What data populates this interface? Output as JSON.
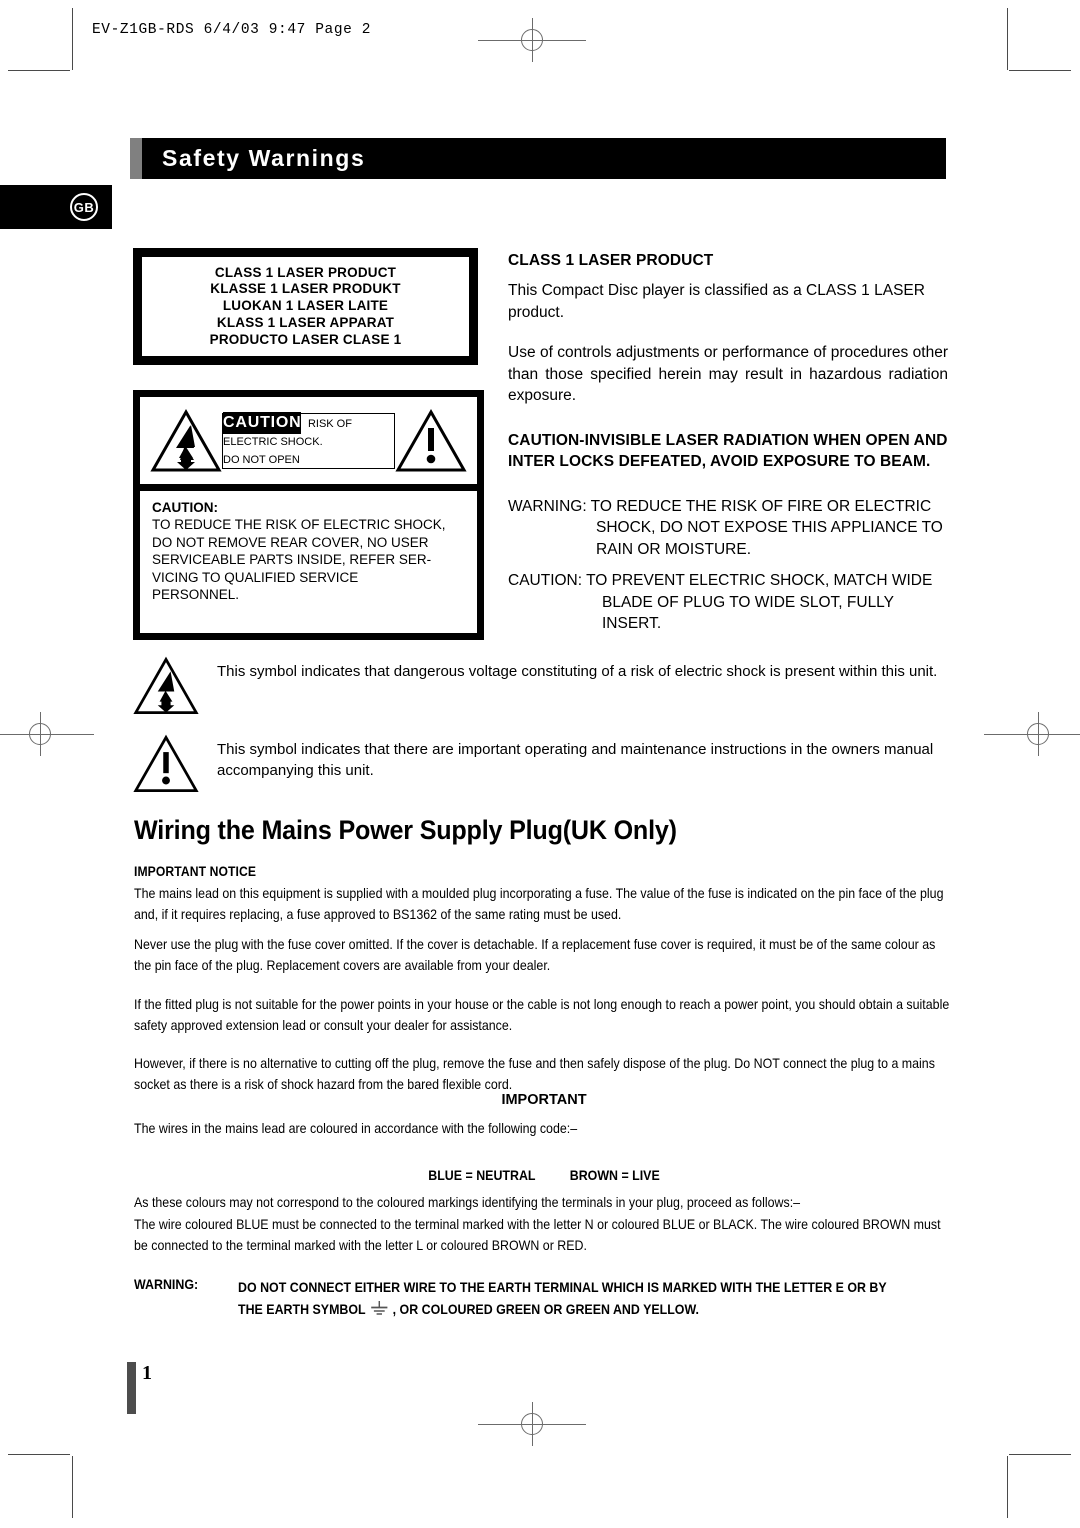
{
  "print_header": {
    "text": "EV-Z1GB-RDS  6/4/03 9:47  Page 2"
  },
  "header": {
    "title": "Safety Warnings",
    "region_badge": "GB"
  },
  "laser_label_box": {
    "lines": [
      "CLASS 1 LASER PRODUCT",
      "KLASSE 1 LASER PRODUKT",
      "LUOKAN 1 LASER LAITE",
      "KLASS 1 LASER APPARAT",
      "PRODUCTO LASER CLASE 1"
    ]
  },
  "caution_label": {
    "heading": "CAUTION",
    "line1": "RISK OF ELECTRIC SHOCK.",
    "line2": "DO NOT OPEN",
    "body_heading": "CAUTION:",
    "body": "TO REDUCE THE RISK OF ELECTRIC SHOCK, DO NOT REMOVE REAR COVER, NO USER SERVICEABLE PARTS INSIDE, REFER SER-VICING TO QUALIFIED SERVICE PERSONNEL.",
    "body_lines": [
      "TO REDUCE THE RISK OF ELECTRIC SHOCK,",
      "DO NOT REMOVE REAR COVER, NO USER",
      "SERVICEABLE PARTS INSIDE, REFER SER-",
      "VICING TO QUALIFIED SERVICE",
      "PERSONNEL."
    ]
  },
  "right_column": {
    "class1_heading": "CLASS 1 LASER PRODUCT",
    "class1_body": "This Compact Disc player is classified as a CLASS 1 LASER product.",
    "controls_body": "Use of controls adjustments or performance of procedures other than those specified herein may result in hazardous radiation exposure.",
    "invisible_heading": "CAUTION-INVISIBLE LASER RADIATION WHEN OPEN AND INTER LOCKS DEFEATED, AVOID EXPOSURE TO BEAM.",
    "warning_block": "WARNING: TO REDUCE THE RISK OF FIRE OR ELECTRIC SHOCK, DO NOT EXPOSE THIS APPLIANCE TO RAIN OR MOISTURE.",
    "caution_block": "CAUTION: TO PREVENT ELECTRIC SHOCK, MATCH WIDE BLADE OF PLUG TO WIDE SLOT, FULLY INSERT."
  },
  "symbol_explanations": [
    {
      "icon": "lightning-bolt-triangle-icon",
      "text": "This symbol indicates that dangerous voltage constituting of a risk of electric shock is present within this unit."
    },
    {
      "icon": "exclamation-triangle-icon",
      "text": "This symbol indicates that there are important operating and maintenance instructions in the owners manual accompanying this unit."
    }
  ],
  "wiring": {
    "title": "Wiring the Mains Power Supply Plug(UK Only)",
    "important_notice_heading": "IMPORTANT NOTICE",
    "para1": "The mains lead on this equipment is supplied with a moulded plug incorporating a fuse. The value of the fuse is indicated on the pin face of the plug and, if it requires replacing, a fuse approved to BS1362 of the same rating must be used.",
    "para2": "Never use the plug with the fuse cover omitted. If the cover is detachable. If a replacement fuse cover is required, it must be of the same colour as the pin face of the plug. Replacement covers are available from your dealer.",
    "para3": "If the fitted plug is not suitable for the power points in your house or the cable is not long enough to reach a power point, you should obtain a suitable safety approved extension lead or consult your dealer for assistance.",
    "para4": "However, if there is no alternative to cutting off the plug, remove the fuse and then safely dispose of the plug. Do NOT connect the plug to a mains socket as there is a risk of shock hazard from the bared flexible cord.",
    "important_heading": "IMPORTANT",
    "para5": "The wires in the mains lead are coloured in accordance with the following code:–",
    "code_blue": "BLUE = NEUTRAL",
    "code_brown": "BROWN = LIVE",
    "para6": "As these colours may not correspond to the coloured markings identifying the terminals in your plug, proceed as follows:–",
    "para7": "The wire coloured BLUE must be connected to the terminal marked with the letter N or coloured BLUE or BLACK. The wire coloured BROWN must be connected to the terminal marked with the letter L or coloured BROWN or RED.",
    "warning_label": "WARNING:",
    "warning_line1": "DO NOT CONNECT EITHER WIRE TO THE EARTH TERMINAL WHICH IS MARKED WITH THE LETTER E OR BY",
    "warning_line2a": "THE EARTH SYMBOL",
    "warning_line2b": ", OR COLOURED GREEN OR GREEN AND YELLOW."
  },
  "footer": {
    "page_number": "1"
  },
  "colors": {
    "accent_gray": "#808080",
    "bar_black": "#000000",
    "footer_gray": "#4d4d4d"
  }
}
